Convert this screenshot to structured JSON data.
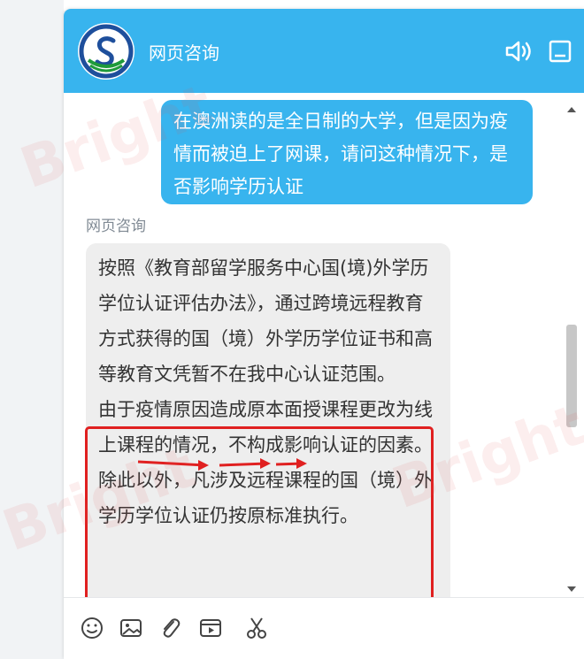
{
  "header": {
    "title": "网页咨询"
  },
  "messages": {
    "user": {
      "text": "在澳洲读的是全日制的大学，但是因为疫情而被迫上了网课，请问这种情况下，是否影响学历认证"
    },
    "agent": {
      "sender": "网页咨询",
      "paragraph1": "按照《教育部留学服务中心国(境)外学历学位认证评估办法》，通过跨境远程教育方式获得的国（境）外学历学位证书和高等教育文凭暂不在我中心认证范围。",
      "paragraph2": "由于疫情原因造成原本面授课程更改为线上课程的情况，不构成影响认证的因素。除此以外，凡涉及远程课程的国（境）外学历学位认证仍按原标准执行。"
    }
  },
  "watermark": {
    "text": "Bright"
  },
  "colors": {
    "header_bg": "#38b4ee",
    "user_bubble": "#38b4ee",
    "agent_bubble": "#eeeeee",
    "highlight": "#e02020",
    "logo_blue": "#1e4f9c",
    "logo_green": "#1f9a3a"
  },
  "icons": {
    "header": [
      "logo",
      "sound-icon",
      "minimize-icon"
    ],
    "toolbar": [
      "emoji-icon",
      "image-icon",
      "attachment-icon",
      "video-icon",
      "scissors-icon"
    ]
  }
}
